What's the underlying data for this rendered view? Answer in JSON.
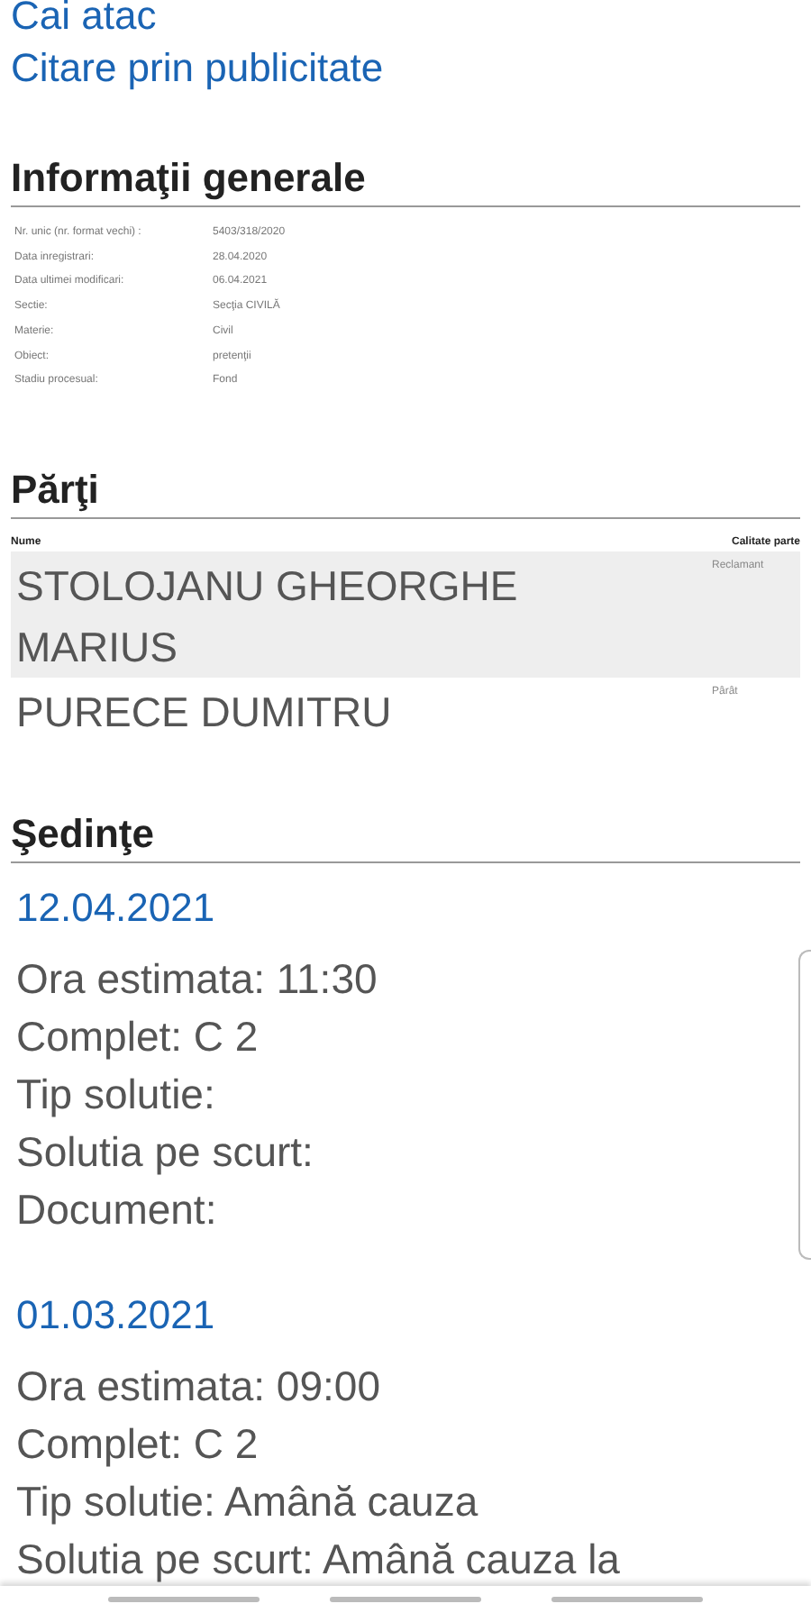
{
  "links": [
    "Cai atac",
    "Citare prin publicitate"
  ],
  "general": {
    "title": "Informaţii generale",
    "rows": [
      {
        "label": "Nr. unic (nr. format vechi) :",
        "value": "5403/318/2020"
      },
      {
        "label": "Data inregistrari:",
        "value": "28.04.2020"
      },
      {
        "label": "Data ultimei modificari:",
        "value": "06.04.2021"
      },
      {
        "label": "Sectie:",
        "value": "Secţia CIVILĂ"
      },
      {
        "label": "Materie:",
        "value": "Civil"
      },
      {
        "label": "Obiect:",
        "value": "pretenţii"
      },
      {
        "label": "Stadiu procesual:",
        "value": "Fond"
      }
    ]
  },
  "parties": {
    "title": "Părţi",
    "columns": [
      "Nume",
      "Calitate parte"
    ],
    "rows": [
      {
        "name": "STOLOJANU GHEORGHE MARIUS",
        "role": "Reclamant",
        "selected": true
      },
      {
        "name": "PURECE DUMITRU",
        "role": "Pârât",
        "selected": false
      }
    ]
  },
  "sessions": {
    "title": "Şedinţe",
    "items": [
      {
        "date": "12.04.2021",
        "lines": [
          "Ora estimata: 11:30",
          "Complet: C 2",
          "Tip solutie:",
          "Solutia pe scurt:",
          "Document:"
        ]
      },
      {
        "date": "01.03.2021",
        "lines": [
          "Ora estimata: 09:00",
          "Complet: C 2",
          "Tip solutie: Amână cauza",
          "Solutia pe scurt: Amână cauza la"
        ]
      }
    ]
  }
}
